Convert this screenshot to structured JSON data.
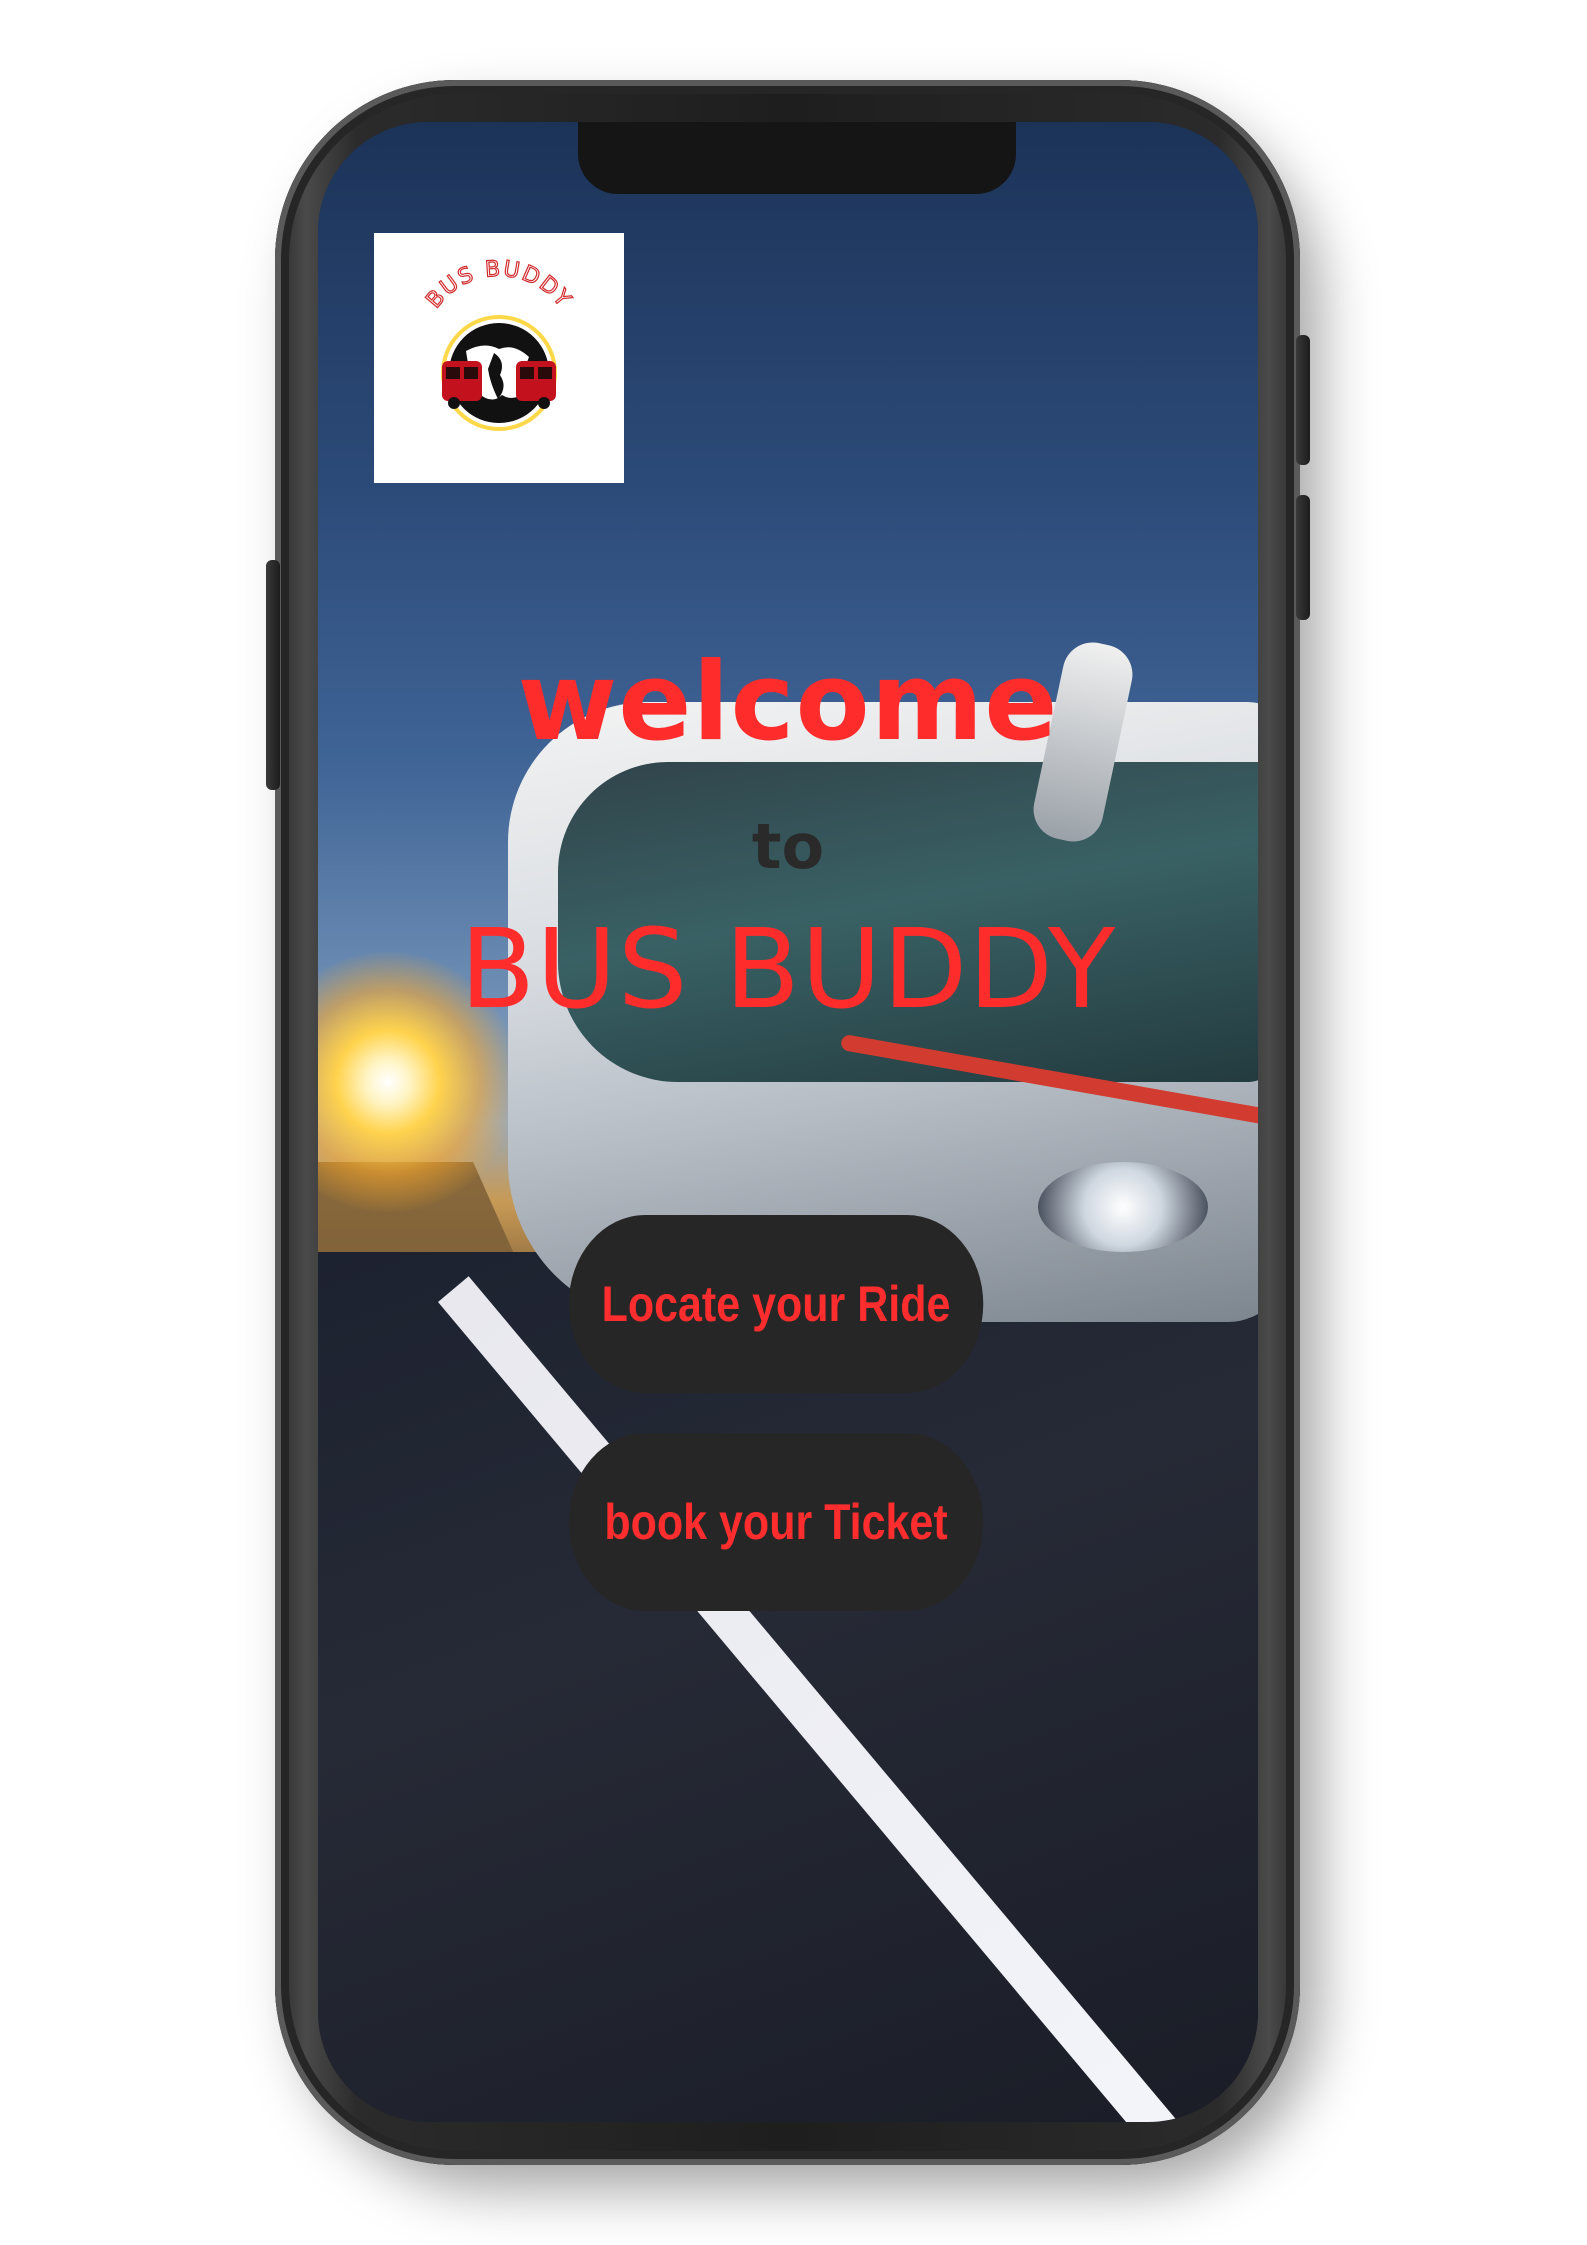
{
  "logo": {
    "text": "BUS BUDDY",
    "icon": "globe-bus-logo"
  },
  "hero": {
    "line1": "welcome",
    "line2": "to",
    "line3": "BUS BUDDY"
  },
  "actions": {
    "locate_label": "Locate your Ride",
    "book_label": "book your Ticket"
  },
  "colors": {
    "accent": "#ff2c2c",
    "button_bg": "#262626",
    "phone_frame": "#1e1e1e"
  }
}
